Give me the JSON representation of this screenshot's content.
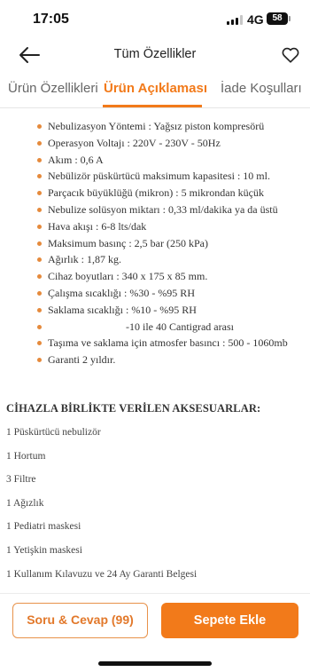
{
  "status_bar": {
    "time": "17:05",
    "network": "4G",
    "battery": "58"
  },
  "header": {
    "title": "Tüm Özellikler",
    "back_icon": "arrow-left-icon",
    "favorite_icon": "heart-icon"
  },
  "tabs": [
    {
      "label": "Ürün Özellikleri",
      "active": false
    },
    {
      "label": "Ürün Açıklaması",
      "active": true
    },
    {
      "label": "İade Koşulları",
      "active": false
    }
  ],
  "accent_color": "#f27a1a",
  "bullet_color": "#e58a3c",
  "specs": [
    "Nebulizasyon Yöntemi : Yağsız piston kompresörü",
    "Operasyon Voltajı : 220V - 230V - 50Hz",
    "Akım : 0,6 A",
    "Nebülizör püskürtücü maksimum kapasitesi : 10 ml.",
    "Parçacık büyüklüğü (mikron) : 5 mikrondan küçük",
    "Nebulize solüsyon miktarı : 0,33 ml/dakika ya da üstü",
    "Hava akışı : 6-8 lts/dak",
    "Maksimum basınç : 2,5 bar (250 kPa)",
    "Ağırlık : 1,87 kg.",
    "Cihaz boyutları : 340 x 175 x 85 mm.",
    "Çalışma sıcaklığı : %30 - %95 RH",
    "Saklama sıcaklığı : %10 - %95 RH",
    "-10 ile 40 Cantigrad arası",
    "Taşıma ve saklama için atmosfer basıncı : 500 - 1060mb",
    "Garanti 2 yıldır."
  ],
  "accessories": {
    "title": "CİHAZLA BİRLİKTE VERİLEN AKSESUARLAR:",
    "items": [
      "1 Püskürtücü nebulizör",
      "1 Hortum",
      "3 Filtre",
      "1 Ağızlık",
      "1 Pediatri maskesi",
      "1 Yetişkin maskesi",
      "1 Kullanım Kılavuzu ve 24 Ay Garanti Belgesi"
    ]
  },
  "bottom": {
    "qa_label": "Soru & Cevap (99)",
    "cart_label": "Sepete Ekle"
  }
}
